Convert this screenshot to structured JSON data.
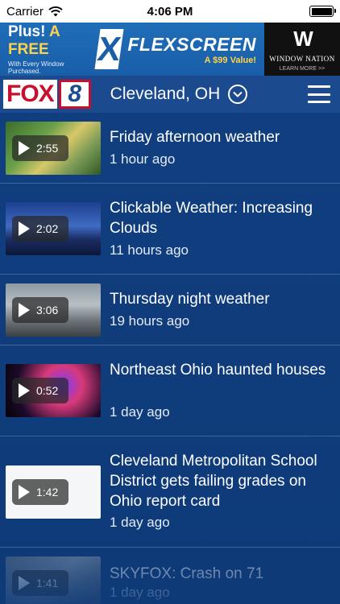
{
  "status_bar": {
    "carrier": "Carrier",
    "time": "4:06 PM",
    "battery_level": 1.0
  },
  "ad": {
    "headline_prefix": "Plus! ",
    "headline_highlight": "A FREE",
    "subline": "With Every Window Purchased.",
    "x_mark": "X",
    "brand": "FLEXSCREEN",
    "value": "A $99 Value!",
    "side_logo": "W",
    "side_name": "WINDOW NATION",
    "side_cta": "LEARN MORE >>"
  },
  "header": {
    "logo_fox": "FOX",
    "logo_number": "8",
    "location": "Cleveland, OH"
  },
  "videos": [
    {
      "duration": "2:55",
      "title": "Friday afternoon weather",
      "time": "1 hour ago",
      "thumb": "radar-map"
    },
    {
      "duration": "2:02",
      "title": "Clickable Weather: Increasing Clouds",
      "time": "11 hours ago",
      "thumb": "forecast-board"
    },
    {
      "duration": "3:06",
      "title": "Thursday night weather",
      "time": "19 hours ago",
      "thumb": "skyline"
    },
    {
      "duration": "0:52",
      "title": "Northeast Ohio haunted houses",
      "time": "1 day ago",
      "thumb": "haunted-house"
    },
    {
      "duration": "1:42",
      "title": "Cleveland Metropolitan School District gets failing grades on Ohio report card",
      "time": "1 day ago",
      "thumb": "report-card"
    },
    {
      "duration": "1:41",
      "title": "SKYFOX: Crash on 71",
      "time": "1 day ago",
      "thumb": "aerial"
    }
  ]
}
